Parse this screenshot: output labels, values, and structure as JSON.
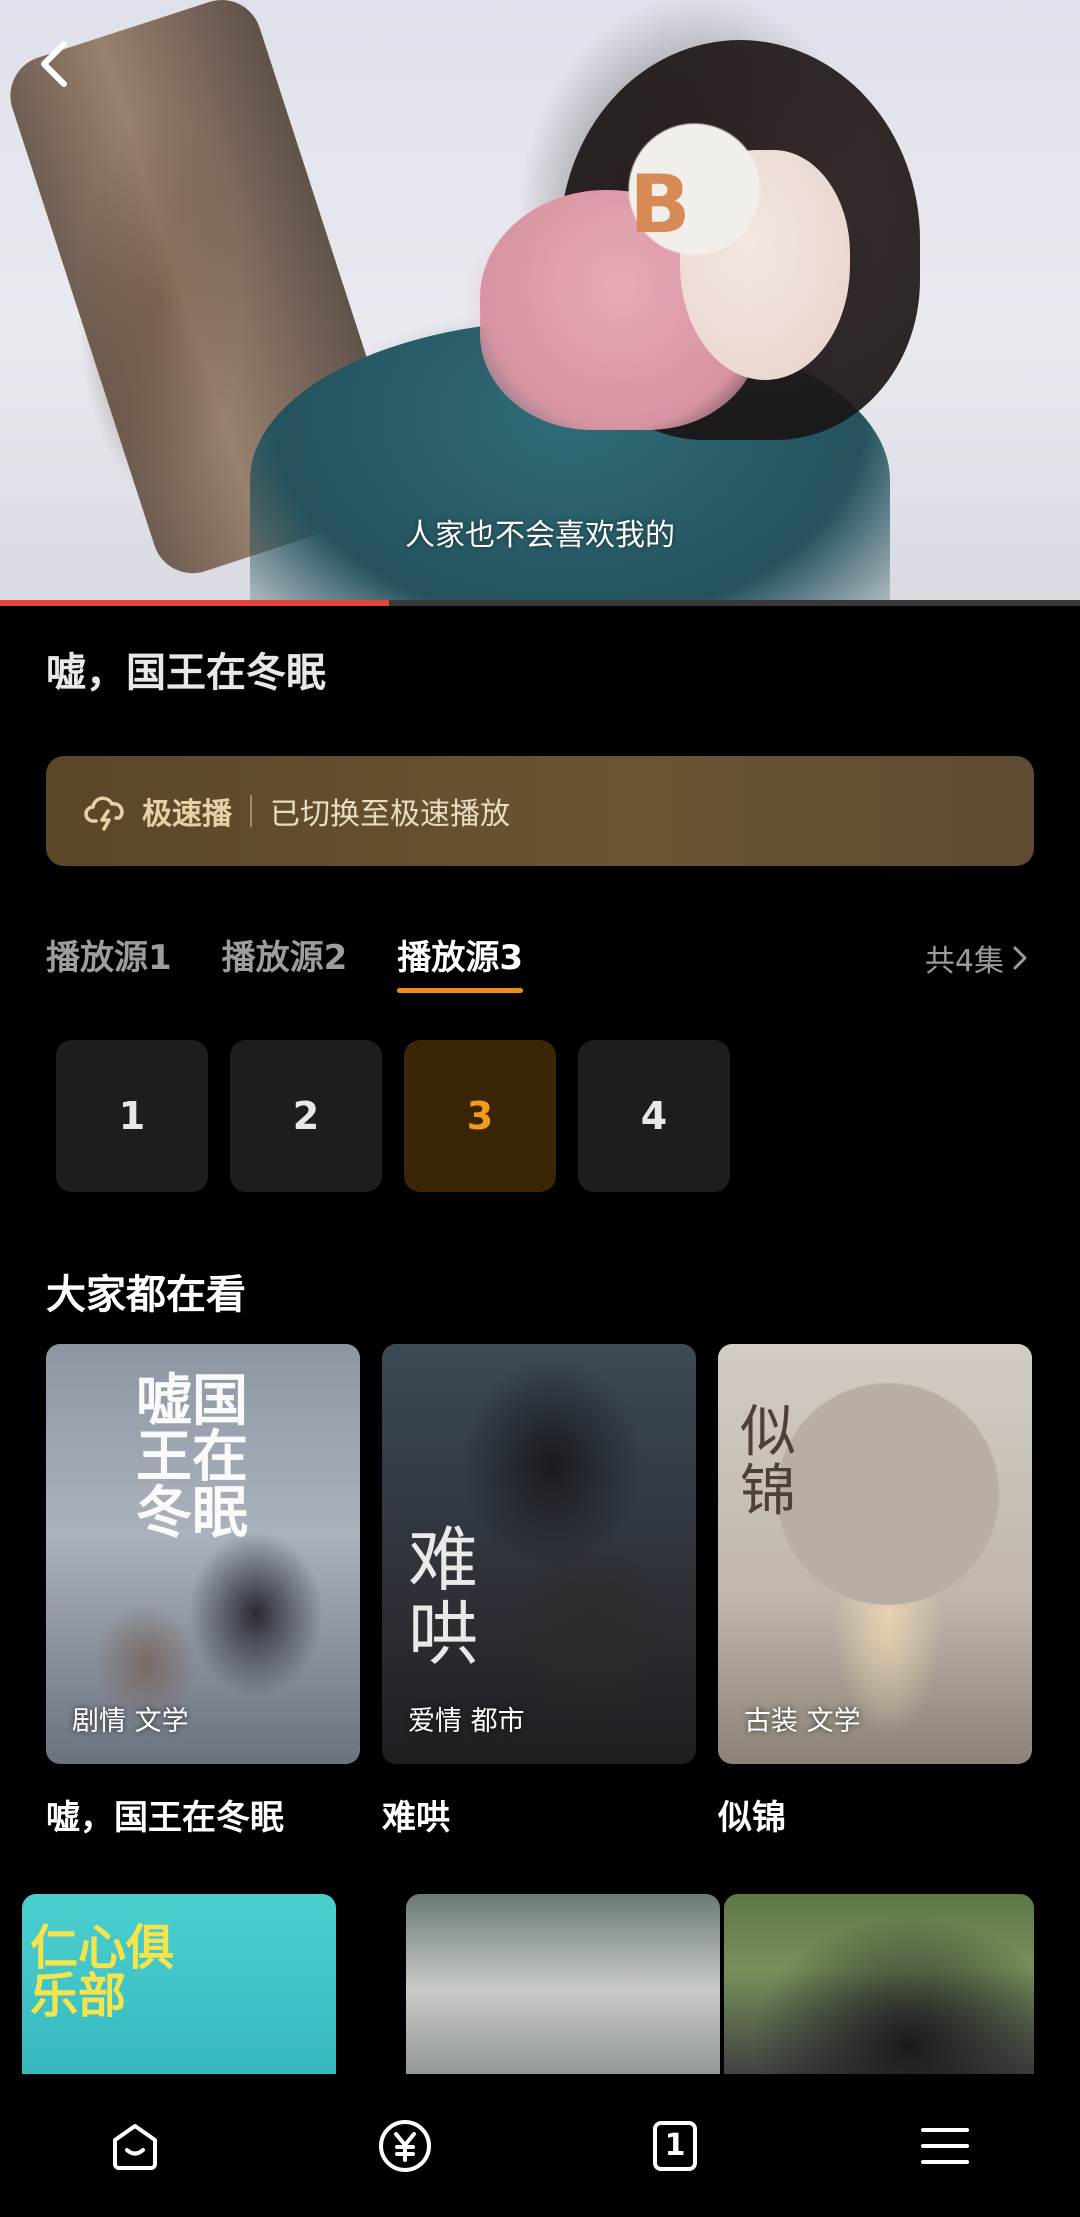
{
  "video": {
    "subtitle": "人家也不会喜欢我的",
    "progress_fraction": 0.36
  },
  "show": {
    "title": "嘘，国王在冬眠"
  },
  "speed_banner": {
    "label": "极速播",
    "message": "已切换至极速播放",
    "accent_color": "#e7cfa6"
  },
  "sources": {
    "tabs": [
      "播放源1",
      "播放源2",
      "播放源3"
    ],
    "active_index": 2,
    "episode_count_label": "共4集",
    "accent_color": "#f08c1b"
  },
  "episodes": {
    "items": [
      "1",
      "2",
      "3",
      "4"
    ],
    "active_index": 2
  },
  "recommend": {
    "title": "大家都在看",
    "cards": [
      {
        "name": "嘘，国王在冬眠",
        "tags": "剧情 文学",
        "poster_text": "嘘国王在冬眠"
      },
      {
        "name": "难哄",
        "tags": "爱情 都市",
        "poster_text": "难哄"
      },
      {
        "name": "似锦",
        "tags": "古装 文学",
        "poster_text": "似锦"
      }
    ],
    "row2_posters": [
      {
        "poster_text": "仁心俱乐部"
      }
    ]
  },
  "bottom_nav": {
    "items": [
      {
        "icon": "home-icon"
      },
      {
        "icon": "yuan-coin-icon"
      },
      {
        "icon": "tab-count-icon",
        "badge": "1"
      },
      {
        "icon": "menu-icon"
      }
    ]
  }
}
